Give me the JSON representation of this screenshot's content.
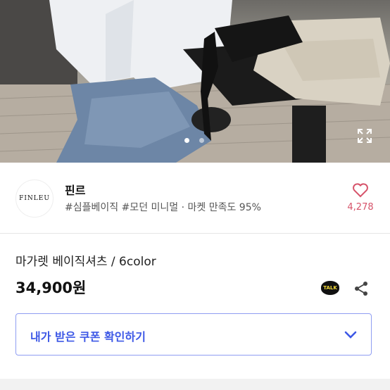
{
  "shop": {
    "logo_text": "FINLEU",
    "name": "핀르",
    "tags": "#심플베이직 #모던 미니멀 · 마켓 만족도 95%",
    "likes": "4,278"
  },
  "product": {
    "title": "마가렛 베이직셔츠 / 6color",
    "price": "34,900원",
    "talk_label": "TALK"
  },
  "coupon": {
    "label": "내가 받은 쿠폰 확인하기"
  },
  "carousel": {
    "active_index": 0,
    "total": 2
  },
  "icons": [
    "expand-icon",
    "heart-icon",
    "kakao-talk-icon",
    "share-icon",
    "chevron-down-icon"
  ],
  "colors": {
    "accent": "#3d58e6",
    "like": "#d6536a",
    "coupon_border": "#8f9df2"
  }
}
